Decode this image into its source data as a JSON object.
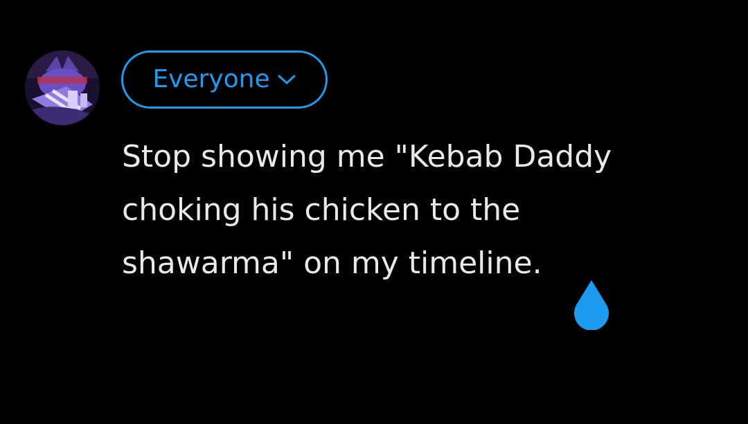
{
  "composer": {
    "avatar_icon": "user-avatar",
    "audience_button": {
      "label": "Everyone",
      "icon": "chevron-down-icon",
      "color": "#1d9bf0"
    },
    "text": "Stop showing me \"Kebab Daddy choking his chicken to the shawarma\" on my timeline.",
    "text_lines": [
      "Stop showing me \"Kebab Daddy",
      "choking his chicken to the",
      "shawarma\" on my timeline."
    ],
    "cursor_handle_icon": "text-cursor-handle-icon",
    "text_color": "#e7e9ea",
    "background_color": "#000000"
  }
}
